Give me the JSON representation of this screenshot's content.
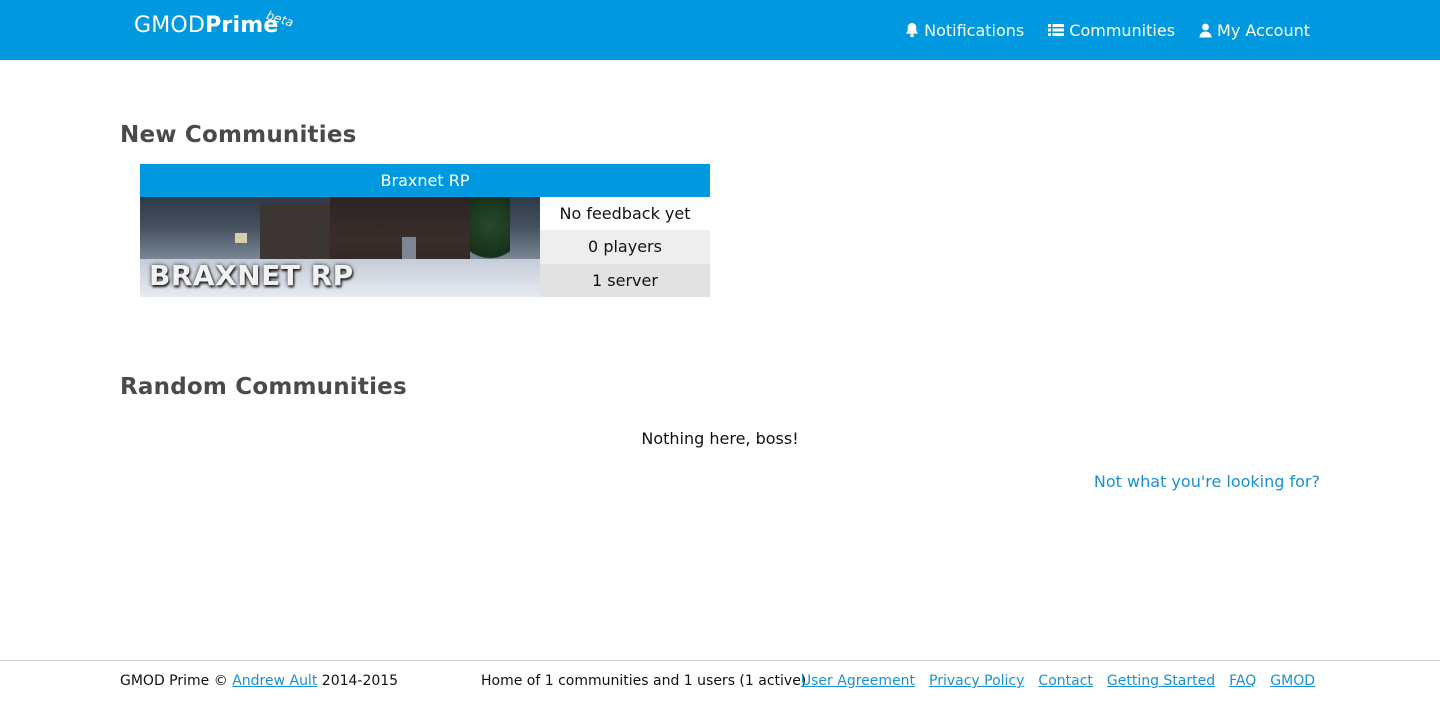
{
  "header": {
    "logo_primary": "GMOD",
    "logo_secondary": "Prime",
    "logo_badge": "beta",
    "nav": [
      {
        "label": "Notifications",
        "icon": "bell-icon"
      },
      {
        "label": "Communities",
        "icon": "list-icon"
      },
      {
        "label": "My Account",
        "icon": "user-icon"
      }
    ],
    "colors": {
      "bar": "#0099e0",
      "text": "#ffffff"
    }
  },
  "new_communities": {
    "title": "New Communities",
    "cards": [
      {
        "name": "Braxnet RP",
        "banner_text": "BRAXNET RP",
        "feedback": "No feedback yet",
        "players": "0 players",
        "servers": "1 server"
      }
    ]
  },
  "random_communities": {
    "title": "Random Communities",
    "empty_message": "Nothing here, boss!"
  },
  "looking_link": "Not what you're looking for?",
  "footer": {
    "brand": "GMOD Prime ©",
    "author": "Andrew Ault",
    "years": "2014-2015",
    "stats": "Home of 1 communities and 1 users (1 active)",
    "links": [
      "User Agreement",
      "Privacy Policy",
      "Contact",
      "Getting Started",
      "FAQ",
      "GMOD"
    ]
  }
}
